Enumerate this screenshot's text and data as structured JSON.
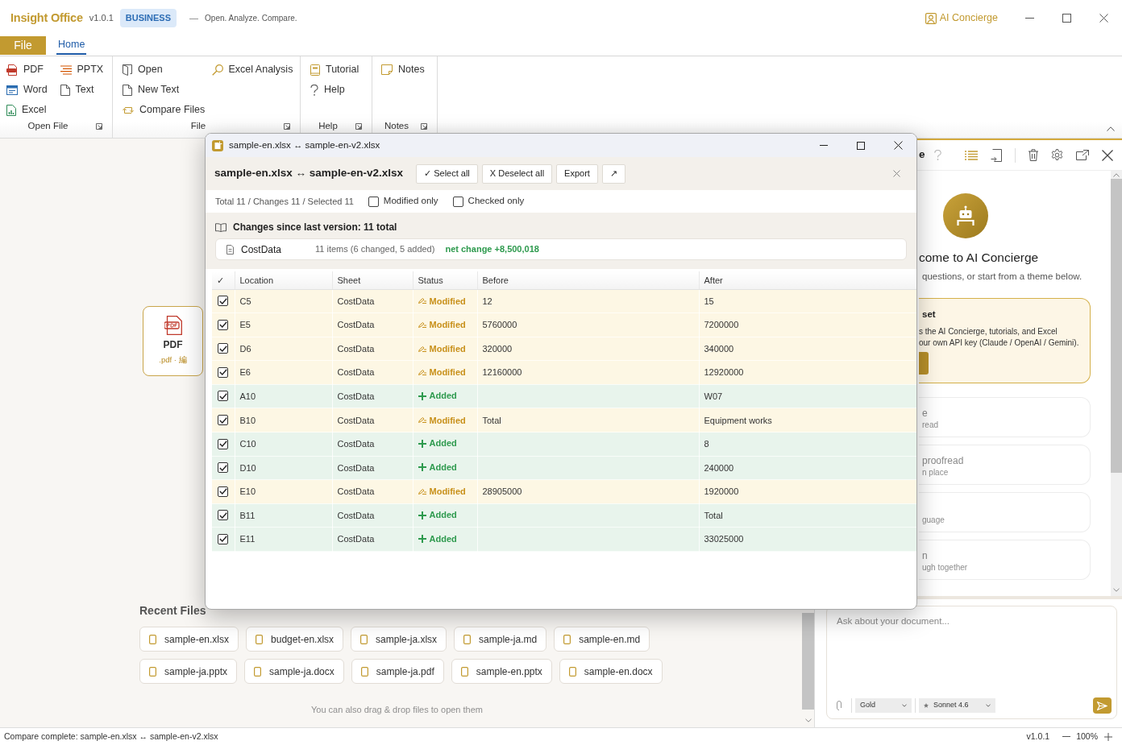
{
  "titlebar": {
    "app_name": "Insight Office",
    "version": "v1.0.1",
    "edition": "BUSINESS",
    "separator": "—",
    "tagline": "Open. Analyze. Compare.",
    "concierge_button": "AI Concierge"
  },
  "file_button": "File",
  "tabs": [
    {
      "label": "Home",
      "selected": true
    }
  ],
  "ribbon": {
    "groups": [
      {
        "label": "Open File",
        "columns": [
          [
            "PDF",
            "Word",
            "Excel"
          ],
          [
            "PPTX",
            "Text"
          ]
        ]
      },
      {
        "label": "File",
        "columns": [
          [
            "Open",
            "New Text",
            "Compare Files"
          ],
          [
            "Excel Analysis"
          ]
        ]
      },
      {
        "label": "Help",
        "columns": [
          [
            "Tutorial",
            "Help"
          ]
        ]
      },
      {
        "label": "Notes",
        "columns": [
          [
            "Notes"
          ]
        ]
      }
    ]
  },
  "start_page": {
    "file_card": {
      "title": "PDF",
      "subtitle": ".pdf · 編"
    },
    "recent_title": "Recent Files",
    "recent_files": [
      "sample-en.xlsx",
      "budget-en.xlsx",
      "sample-ja.xlsx",
      "sample-ja.md",
      "sample-en.md",
      "sample-ja.pptx",
      "sample-ja.docx",
      "sample-ja.pdf",
      "sample-en.pptx",
      "sample-en.docx"
    ],
    "drop_hint": "You can also drag & drop files to open them"
  },
  "concierge": {
    "title": "e",
    "welcome_title": "come to AI Concierge",
    "welcome_text": "questions, or start from a theme below.",
    "notice": {
      "title": "set",
      "lines": [
        "s the AI Concierge, tutorials, and Excel",
        "our own API key (Claude / OpenAI / Gemini)."
      ]
    },
    "themes": [
      {
        "title": "e",
        "subtitle": "read"
      },
      {
        "title": "proofread",
        "subtitle": "n place"
      },
      {
        "subtitle": "guage"
      },
      {
        "title": "n",
        "subtitle": "ugh together"
      }
    ],
    "input_placeholder": "Ask about your document...",
    "plan_select": "Gold",
    "model_select": "Sonnet 4.6"
  },
  "compare_dialog": {
    "window_title": "sample-en.xlsx ↔ sample-en-v2.xlsx",
    "heading": "sample-en.xlsx ↔ sample-en-v2.xlsx",
    "buttons": [
      "✓ Select all",
      "X Deselect all",
      "Export",
      "↗"
    ],
    "summary_counts": "Total 11 / Changes 11 / Selected 11",
    "filters": [
      {
        "label": "Modified only",
        "checked": false
      },
      {
        "label": "Checked only",
        "checked": false
      }
    ],
    "changes_title": "Changes since last version: 11 total",
    "sheet_summary": {
      "sheet": "CostData",
      "counts": "11 items (6 changed, 5 added)",
      "net_change": "net change +8,500,018"
    },
    "table": {
      "columns": [
        "✓",
        "Location",
        "Sheet",
        "Status",
        "Before",
        "After"
      ],
      "rows": [
        {
          "checked": true,
          "location": "C5",
          "sheet": "CostData",
          "kind": "modified",
          "status": "Modified",
          "before": "12",
          "after": "15"
        },
        {
          "checked": true,
          "location": "E5",
          "sheet": "CostData",
          "kind": "modified",
          "status": "Modified",
          "before": "5760000",
          "after": "7200000"
        },
        {
          "checked": true,
          "location": "D6",
          "sheet": "CostData",
          "kind": "modified",
          "status": "Modified",
          "before": "320000",
          "after": "340000"
        },
        {
          "checked": true,
          "location": "E6",
          "sheet": "CostData",
          "kind": "modified",
          "status": "Modified",
          "before": "12160000",
          "after": "12920000"
        },
        {
          "checked": true,
          "location": "A10",
          "sheet": "CostData",
          "kind": "added",
          "status": "Added",
          "after": "W07"
        },
        {
          "checked": true,
          "location": "B10",
          "sheet": "CostData",
          "kind": "modified",
          "status": "Modified",
          "before": "Total",
          "after": "Equipment works"
        },
        {
          "checked": true,
          "location": "C10",
          "sheet": "CostData",
          "kind": "added",
          "status": "Added",
          "after": "8"
        },
        {
          "checked": true,
          "location": "D10",
          "sheet": "CostData",
          "kind": "added",
          "status": "Added",
          "after": "240000"
        },
        {
          "checked": true,
          "location": "E10",
          "sheet": "CostData",
          "kind": "modified",
          "status": "Modified",
          "before": "28905000",
          "after": "1920000"
        },
        {
          "checked": true,
          "location": "B11",
          "sheet": "CostData",
          "kind": "added",
          "status": "Added",
          "after": "Total"
        },
        {
          "checked": true,
          "location": "E11",
          "sheet": "CostData",
          "kind": "added",
          "status": "Added",
          "after": "33025000"
        }
      ]
    }
  },
  "status_bar": {
    "message": "Compare complete: sample-en.xlsx ↔ sample-en-v2.xlsx",
    "version": "v1.0.1",
    "zoom": "100%"
  }
}
